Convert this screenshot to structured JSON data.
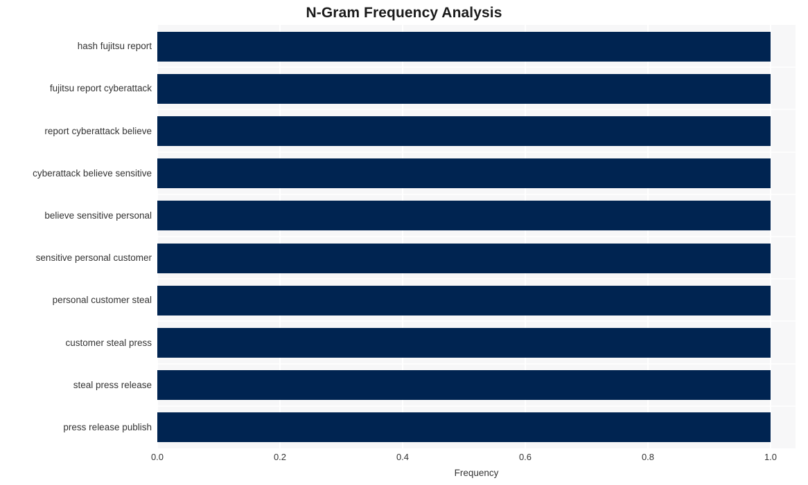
{
  "chart_data": {
    "type": "bar",
    "orientation": "horizontal",
    "title": "N-Gram Frequency Analysis",
    "xlabel": "Frequency",
    "ylabel": "",
    "categories": [
      "hash fujitsu report",
      "fujitsu report cyberattack",
      "report cyberattack believe",
      "cyberattack believe sensitive",
      "believe sensitive personal",
      "sensitive personal customer",
      "personal customer steal",
      "customer steal press",
      "steal press release",
      "press release publish"
    ],
    "values": [
      1.0,
      1.0,
      1.0,
      1.0,
      1.0,
      1.0,
      1.0,
      1.0,
      1.0,
      1.0
    ],
    "xlim": [
      0.0,
      1.0
    ],
    "xticks": [
      "0.0",
      "0.2",
      "0.4",
      "0.6",
      "0.8",
      "1.0"
    ],
    "xtick_values": [
      0.0,
      0.2,
      0.4,
      0.6,
      0.8,
      1.0
    ],
    "grid": true,
    "legend": null,
    "bar_color": "#002451",
    "plot_background": "#f7f7f8",
    "grid_color": "#ffffff",
    "figure_background": "#ffffff",
    "text_color": "#333333",
    "title_color": "#1a1a1a"
  }
}
